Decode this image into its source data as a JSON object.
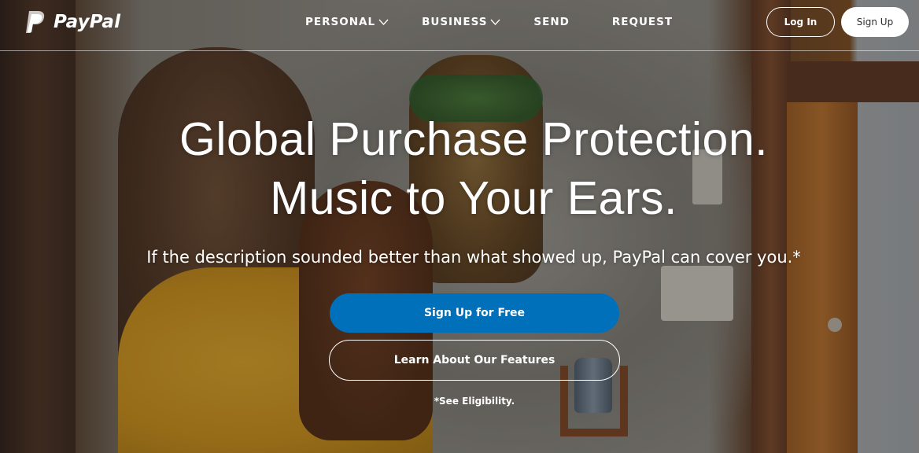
{
  "brand": {
    "name": "PayPal",
    "logo_icon": "paypal-p-icon",
    "color": "#ffffff"
  },
  "nav": {
    "items": [
      {
        "label": "PERSONAL",
        "has_dropdown": true
      },
      {
        "label": "BUSINESS",
        "has_dropdown": true
      },
      {
        "label": "SEND",
        "has_dropdown": false
      },
      {
        "label": "REQUEST",
        "has_dropdown": false
      }
    ],
    "login_label": "Log In",
    "signup_label": "Sign Up"
  },
  "hero": {
    "headline_line1": "Global Purchase Protection.",
    "headline_line2": "Music to Your Ears.",
    "subhead": "If the description sounded better than what showed up, PayPal can cover you.*",
    "primary_cta": "Sign Up for Free",
    "secondary_cta": "Learn About Our Features",
    "footnote": "*See Eligibility."
  },
  "colors": {
    "primary_button": "#0070ba",
    "text": "#ffffff"
  }
}
